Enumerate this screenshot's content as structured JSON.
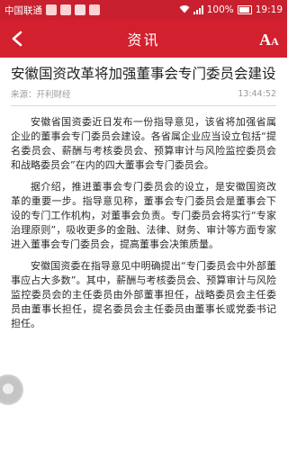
{
  "status_bar": {
    "carrier": "中国联通",
    "battery": "100%",
    "time": "19:19",
    "accent_color": "#c8202e"
  },
  "nav": {
    "back_icon": "chevron-left-icon",
    "title": "资讯",
    "font_size_icon": "font-size-icon",
    "background": "#d3202e"
  },
  "article": {
    "title": "安徽国资改革将加强董事会专门委员会建设",
    "source": "来源：开利财经",
    "time": "13:44:52",
    "paragraphs": [
      "安徽省国资委近日发布一份指导意见，该省将加强省属企业的董事会专门委员会建设。各省属企业应当设立包括“提名委员会、薪酬与考核委员会、预算审计与风险监控委员会和战略委员会”在内的四大董事会专门委员会。",
      "据介绍，推进董事会专门委员会的设立，是安徽国资改革的重要一步。指导意见称，董事会专门委员会是董事会下设的专门工作机构，对董事会负责。专门委员会将实行“专家治理原则”，吸收更多的金融、法律、财务、审计等方面专家进入董事会专门委员会，提高董事会决策质量。",
      "安徽国资委在指导意见中明确提出“专门委员会中外部董事应占大多数”。其中，薪酬与考核委员会、预算审计与风险监控委员会的主任委员由外部董事担任，战略委员会主任委员由董事长担任，提名委员会主任委员由董事长或党委书记担任。"
    ]
  }
}
